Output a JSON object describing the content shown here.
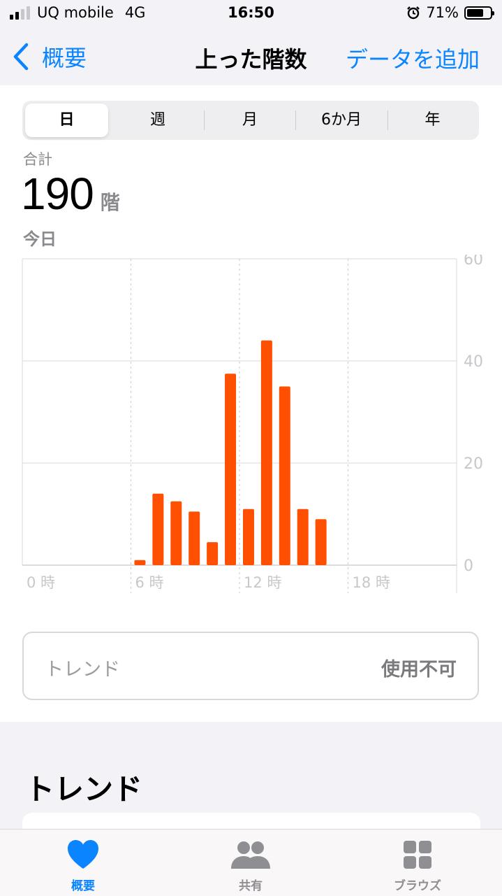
{
  "status_bar": {
    "carrier": "UQ mobile",
    "network": "4G",
    "time": "16:50",
    "battery": "71%",
    "battery_level": 0.71
  },
  "nav": {
    "back_label": "概要",
    "title": "上った階数",
    "add_label": "データを追加"
  },
  "segments": [
    {
      "label": "日",
      "selected": true
    },
    {
      "label": "週"
    },
    {
      "label": "月"
    },
    {
      "label": "6か月"
    },
    {
      "label": "年"
    }
  ],
  "summary": {
    "label": "合計",
    "value": "190",
    "unit": "階",
    "period": "今日"
  },
  "chart_data": {
    "type": "bar",
    "x": [
      6,
      7,
      8,
      9,
      10,
      11,
      12,
      13,
      14,
      15,
      16
    ],
    "values": [
      1,
      14,
      12.5,
      10.5,
      4.5,
      37.5,
      11,
      44,
      35,
      11,
      9
    ],
    "x_tick_labels": [
      "0 時",
      "6 時",
      "12 時",
      "18 時"
    ],
    "y_tick_labels": [
      "60",
      "40",
      "20",
      "0"
    ],
    "ylim": [
      0,
      60
    ],
    "xlim": [
      0,
      24
    ],
    "bar_color": "#ff4f00",
    "grid": true
  },
  "trend_card": {
    "label": "トレンド",
    "value": "使用不可"
  },
  "section": {
    "title": "トレンド"
  },
  "tabbar": {
    "items": [
      {
        "label": "概要",
        "icon": "heart-icon",
        "active": true
      },
      {
        "label": "共有",
        "icon": "people-icon"
      },
      {
        "label": "ブラウズ",
        "icon": "grid-icon"
      }
    ]
  },
  "colors": {
    "accent": "#0a84ff",
    "bar": "#ff4f00"
  }
}
